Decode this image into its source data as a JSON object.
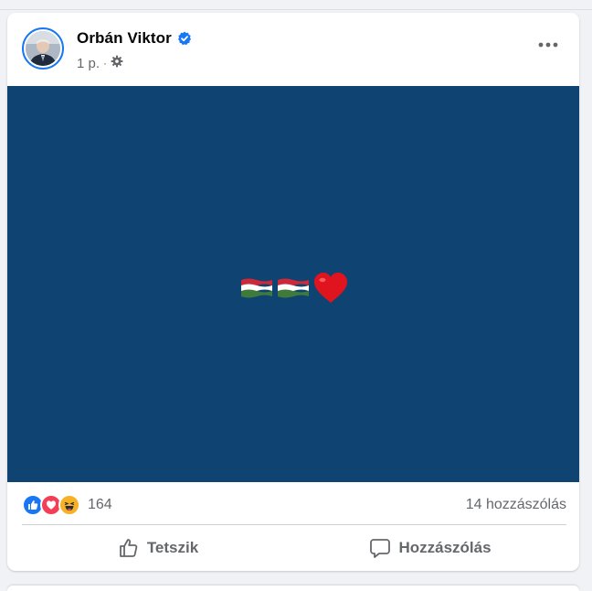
{
  "post": {
    "author": "Orbán Viktor",
    "time": "1 p.",
    "separator": "·",
    "verified_icon": "verified-badge-icon",
    "privacy_icon": "gear-icon",
    "more_icon": "more-icon",
    "media": {
      "background": "#0f4472",
      "emojis": [
        "hungary-flag-emoji",
        "hungary-flag-emoji",
        "red-heart-emoji"
      ]
    },
    "reactions": {
      "icons": [
        "like-icon",
        "love-icon",
        "haha-icon"
      ],
      "count": "164",
      "comments": "14 hozzászólás"
    },
    "actions": {
      "like_label": "Tetszik",
      "comment_label": "Hozzászólás"
    },
    "colors": {
      "accent": "#1877f2",
      "text_secondary": "#65676b",
      "love": "#f33e58",
      "haha": "#f7b125"
    }
  }
}
